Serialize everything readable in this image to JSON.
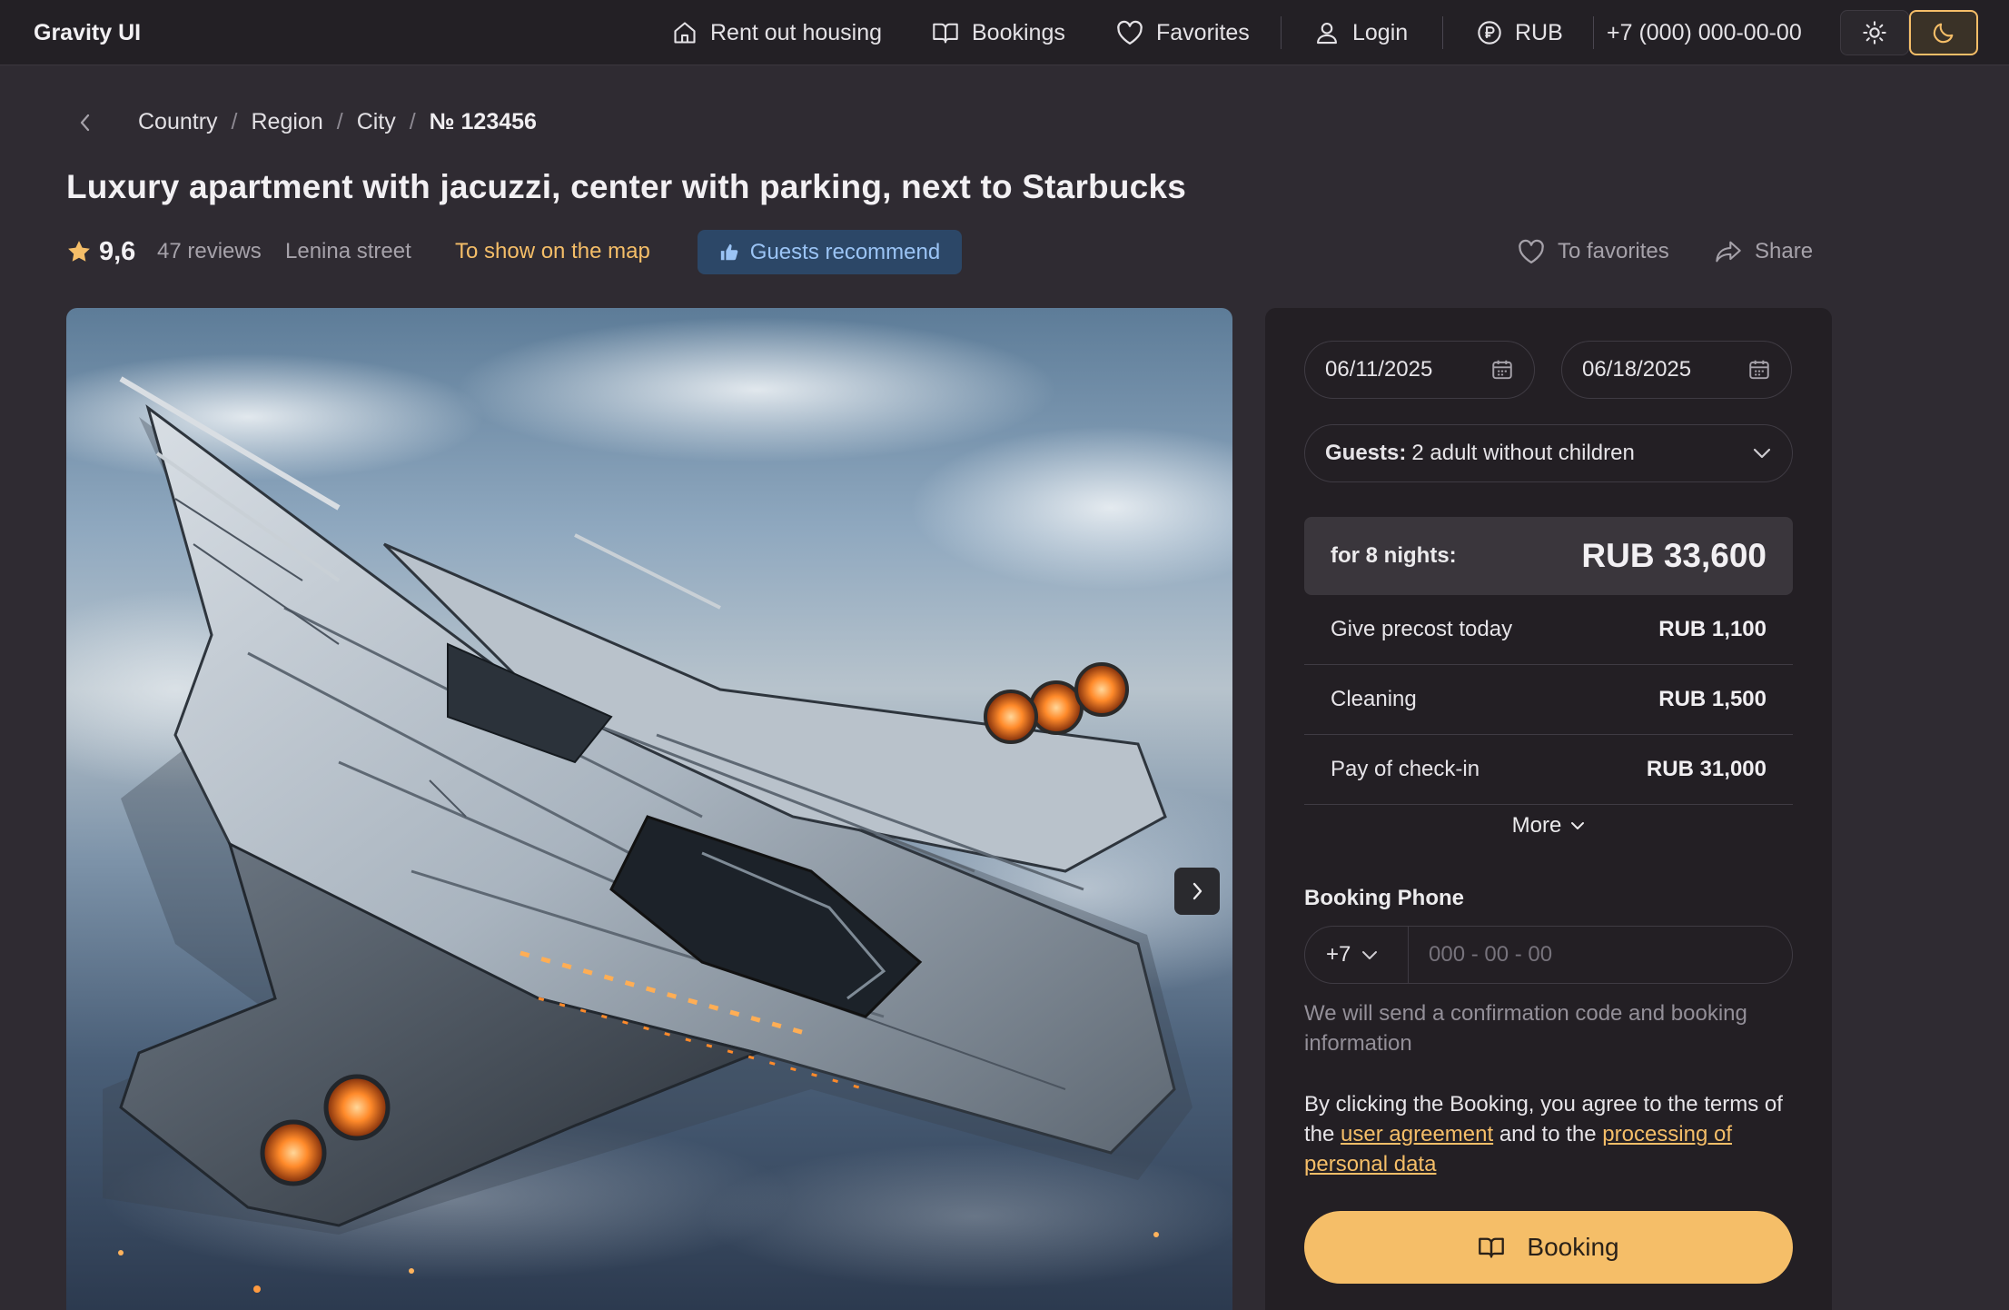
{
  "app": {
    "brand": "Gravity UI"
  },
  "nav": {
    "rent_out": "Rent out housing",
    "bookings": "Bookings",
    "favorites": "Favorites",
    "login": "Login",
    "currency": "RUB",
    "phone": "+7 (000) 000-00-00",
    "theme": "dark"
  },
  "breadcrumb": [
    "Country",
    "Region",
    "City",
    "№ 123456"
  ],
  "listing": {
    "title": "Luxury apartment with jacuzzi, center with parking, next to Starbucks",
    "rating": "9,6",
    "reviews": "47 reviews",
    "street": "Lenina street",
    "map_link": "To show on the map",
    "badge": "Guests recommend",
    "to_favorites": "To favorites",
    "share": "Share"
  },
  "gallery": {
    "image": "spaceship flying above clouds"
  },
  "booking": {
    "check_in": "06/11/2025",
    "check_out": "06/18/2025",
    "guests_label": "Guests:",
    "guests_value": "2 adult without children",
    "total_label": "for 8 nights:",
    "total_value": "RUB 33,600",
    "rows": [
      {
        "label": "Give precost today",
        "value": "RUB 1,100"
      },
      {
        "label": "Cleaning",
        "value": "RUB 1,500"
      },
      {
        "label": "Pay of check-in",
        "value": "RUB 31,000"
      }
    ],
    "more": "More",
    "phone_label": "Booking Phone",
    "phone_code": "+7",
    "phone_placeholder": "000 - 00 - 00",
    "hint": "We will send a confirmation code and booking information",
    "terms_prefix": "By clicking the Booking, you agree to the terms of the",
    "terms_link1": "user agreement",
    "terms_middle": "and to the",
    "terms_link2": "processing of personal data",
    "button": "Booking"
  },
  "colors": {
    "accent": "#f5be68",
    "badge_bg": "#2c4767",
    "badge_text": "#9bc4f5",
    "background": "#2f2b32",
    "panel": "#231f24"
  }
}
